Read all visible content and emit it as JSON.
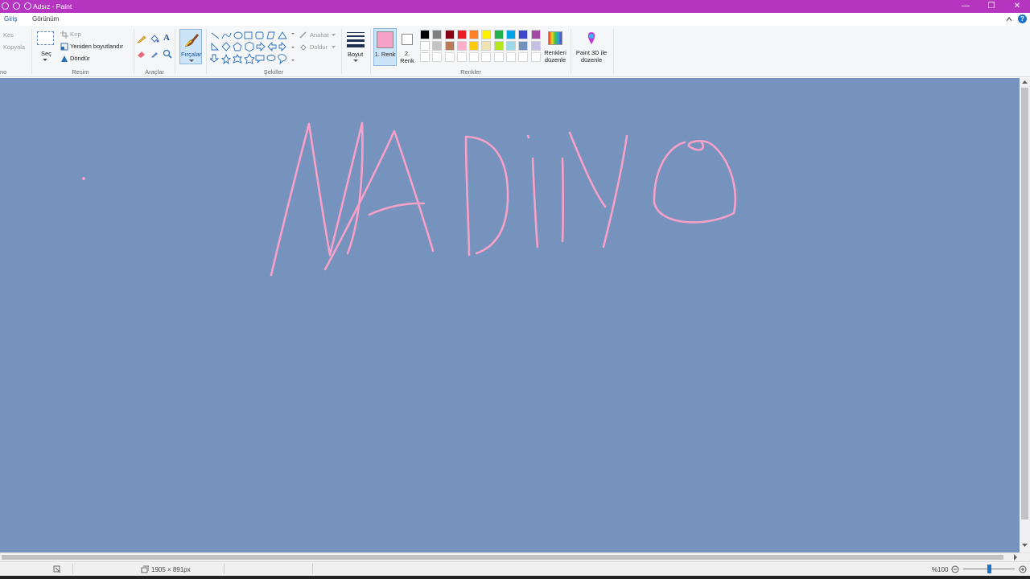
{
  "window": {
    "title": "Adsız - Paint",
    "controls": [
      "—",
      "❐",
      "✕"
    ]
  },
  "menu": {
    "tabs": [
      "Giriş",
      "Görünüm"
    ]
  },
  "ribbon": {
    "clipboard": {
      "cut": "Kes",
      "copy": "Kopyala",
      "label": "no"
    },
    "image": {
      "select": "Seç",
      "crop": "Kırp",
      "resize": "Yeniden boyutlandır",
      "rotate": "Döndür",
      "label": "Resim"
    },
    "tools": {
      "label": "Araçlar",
      "text_glyph": "A"
    },
    "brushes": {
      "label": "Fırçalar"
    },
    "shapes": {
      "outline": "Anahat",
      "fill": "Doldur",
      "label": "Şekiller"
    },
    "size": {
      "label": "Boyut"
    },
    "color1": {
      "label": "1. Renk",
      "value": "#f7a0c8"
    },
    "color2": {
      "label": "2. Renk",
      "value": "#ffffff"
    },
    "colors": {
      "label": "Renkler",
      "palette_row1": [
        "#000000",
        "#7f7f7f",
        "#880015",
        "#ed1c24",
        "#ff7f27",
        "#fff200",
        "#22b14c",
        "#00a2e8",
        "#3f48cc",
        "#a349a4"
      ],
      "palette_row2": [
        "#ffffff",
        "#c3c3c3",
        "#b97a57",
        "#ffaec9",
        "#ffc90e",
        "#efe4b0",
        "#b5e61d",
        "#99d9ea",
        "#7092be",
        "#c8bfe7"
      ],
      "palette_row3": [
        "#ffffff",
        "#ffffff",
        "#ffffff",
        "#ffffff",
        "#ffffff",
        "#ffffff",
        "#ffffff",
        "#ffffff",
        "#ffffff",
        "#ffffff"
      ],
      "edit_colors": "Renkleri düzenle"
    },
    "paint3d": {
      "label": "Paint 3D ile düzenle"
    }
  },
  "canvas": {
    "background": "#7593bd",
    "stroke_color": "#f7a0c8"
  },
  "status": {
    "dimensions": "1905 × 891px",
    "zoom": "%100",
    "zoom_level": 100
  }
}
